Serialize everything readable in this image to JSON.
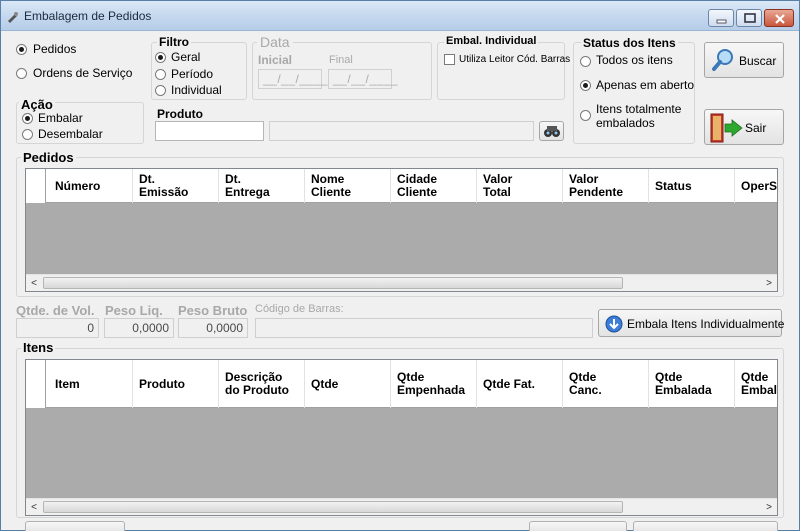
{
  "window": {
    "title": "Embalagem de Pedidos"
  },
  "modo": {
    "options": [
      "Pedidos",
      "Ordens de Serviço"
    ],
    "selected": 0
  },
  "filtro": {
    "label": "Filtro",
    "options": [
      "Geral",
      "Período",
      "Individual"
    ],
    "selected": 0
  },
  "data": {
    "label": "Data",
    "inicial_label": "Inicial",
    "final_label": "Final",
    "inicial_value": "__/__/____",
    "final_value": "__/__/____"
  },
  "embal_individual": {
    "label": "Embal. Individual",
    "checkbox_label": "Utiliza Leitor Cód. Barras"
  },
  "status_itens": {
    "label": "Status dos Itens",
    "options": [
      "Todos os itens",
      "Apenas em aberto",
      "Itens totalmente embalados"
    ],
    "selected": 1
  },
  "buttons": {
    "buscar": "Buscar",
    "sair": "Sair",
    "embala_itens": "Embala Itens Individualmente"
  },
  "acao": {
    "label": "Ação",
    "options": [
      "Embalar",
      "Desembalar"
    ],
    "selected": 0
  },
  "produto": {
    "label": "Produto",
    "code_value": "",
    "desc_value": ""
  },
  "pedidos": {
    "label": "Pedidos",
    "columns": [
      "Número",
      "Dt.\nEmissão",
      "Dt.\nEntrega",
      "Nome\nCliente",
      "Cidade\nCliente",
      "Valor\nTotal",
      "Valor\nPendente",
      "Status",
      "OperS"
    ]
  },
  "volumes": {
    "qtde_vol_label": "Qtde. de Vol.",
    "qtde_vol_value": "0",
    "peso_liq_label": "Peso Liq.",
    "peso_liq_value": "0,0000",
    "peso_bruto_label": "Peso Bruto",
    "peso_bruto_value": "0,0000",
    "codigo_barras_label": "Código de Barras:",
    "codigo_barras_value": ""
  },
  "itens": {
    "label": "Itens",
    "columns": [
      "Item",
      "Produto",
      "Descrição\ndo Produto",
      "Qtde",
      "Qtde\nEmpenhada",
      "Qtde Fat.",
      "Qtde\nCanc.",
      "Qtde\nEmbalada",
      "Qtde\nEmbal"
    ]
  },
  "scroll_glyphs": {
    "left": "<",
    "right": ">"
  },
  "colors": {
    "title_bar": "#c4d7ee",
    "grid_body": "#ababab",
    "accent_blue": "#3b7dd8",
    "sair_arrow": "#2fa82f"
  }
}
